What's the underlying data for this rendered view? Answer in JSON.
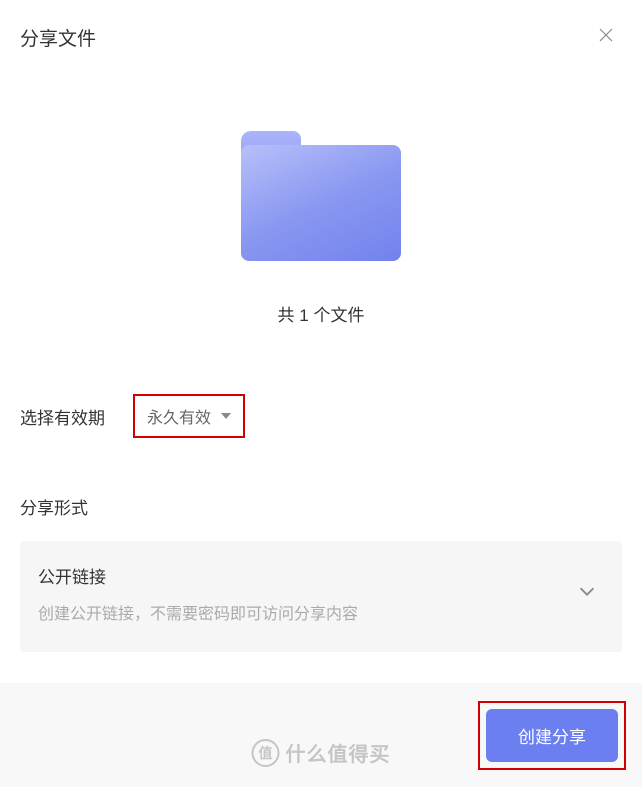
{
  "header": {
    "title": "分享文件"
  },
  "preview": {
    "file_count_text": "共 1 个文件"
  },
  "expiry": {
    "label": "选择有效期",
    "selected": "永久有效"
  },
  "mode": {
    "label": "分享形式",
    "option": {
      "title": "公开链接",
      "desc": "创建公开链接，不需要密码即可访问分享内容"
    }
  },
  "footer": {
    "create_label": "创建分享"
  },
  "watermark": {
    "badge": "值",
    "text": "什么值得买"
  },
  "colors": {
    "accent": "#6b7ff0",
    "highlight_border": "#d40000"
  }
}
